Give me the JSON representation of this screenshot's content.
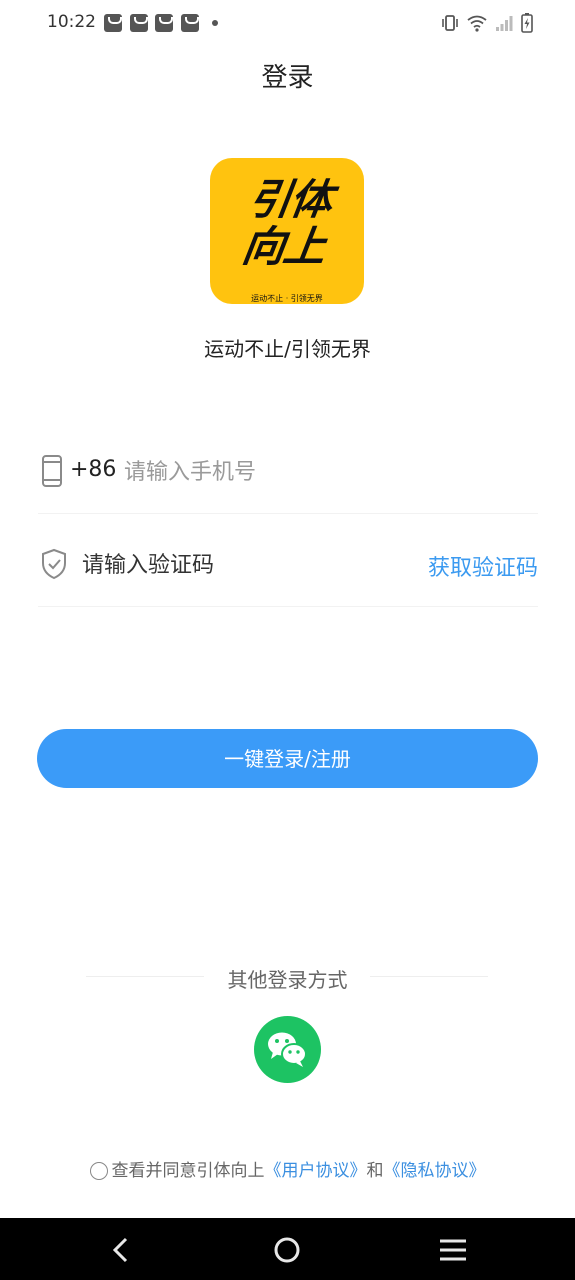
{
  "status_bar": {
    "time": "10:22",
    "icons": [
      "bag-notification-icon",
      "bag-notification-icon",
      "bag-notification-icon",
      "bag-notification-icon",
      "vibrate-icon",
      "wifi-icon",
      "signal-icon",
      "battery-charging-icon"
    ]
  },
  "header": {
    "title": "登录"
  },
  "logo": {
    "text": "引体向上",
    "subtitle": "运动不止 · 引领无界",
    "bg_color": "#FFC30F"
  },
  "slogan": "运动不止/引领无界",
  "phone_field": {
    "country_code": "+86",
    "placeholder": "请输入手机号",
    "value": ""
  },
  "code_field": {
    "placeholder": "请输入验证码",
    "value": "",
    "get_code_label": "获取验证码"
  },
  "login_button": {
    "label": "一键登录/注册",
    "color": "#3B9BF8"
  },
  "other_login": {
    "label": "其他登录方式",
    "methods": [
      "wechat-icon"
    ]
  },
  "agreement": {
    "prefix": "查看并同意引体向上",
    "user_agreement": "《用户协议》",
    "and": "和",
    "privacy_agreement": "《隐私协议》",
    "checked": false
  },
  "nav_bar": {
    "buttons": [
      "back-icon",
      "home-icon",
      "menu-icon"
    ]
  },
  "colors": {
    "accent": "#3B9BF8",
    "link": "#3B8FE0",
    "wechat": "#1DC363"
  }
}
